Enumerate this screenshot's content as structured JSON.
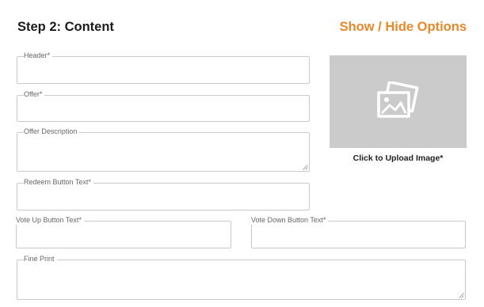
{
  "section": {
    "title": "Step 2: Content",
    "toggle_label": "Show / Hide Options"
  },
  "fields": {
    "header": {
      "label": "Header*",
      "value": ""
    },
    "offer": {
      "label": "Offer*",
      "value": ""
    },
    "offer_description": {
      "label": "Offer Description",
      "value": ""
    },
    "redeem_button_text": {
      "label": "Redeem Button Text*",
      "value": ""
    },
    "vote_up_button_text": {
      "label": "Vote Up Button Text*",
      "value": ""
    },
    "vote_down_button_text": {
      "label": "Vote Down Button Text*",
      "value": ""
    },
    "fine_print": {
      "label": "Fine Print",
      "value": ""
    }
  },
  "image_upload": {
    "label": "Click to Upload Image*",
    "icon": "image-gallery-icon",
    "placeholder_color": "#cbcbcb"
  },
  "colors": {
    "accent": "#e8882a",
    "border": "#c9c9c9"
  }
}
